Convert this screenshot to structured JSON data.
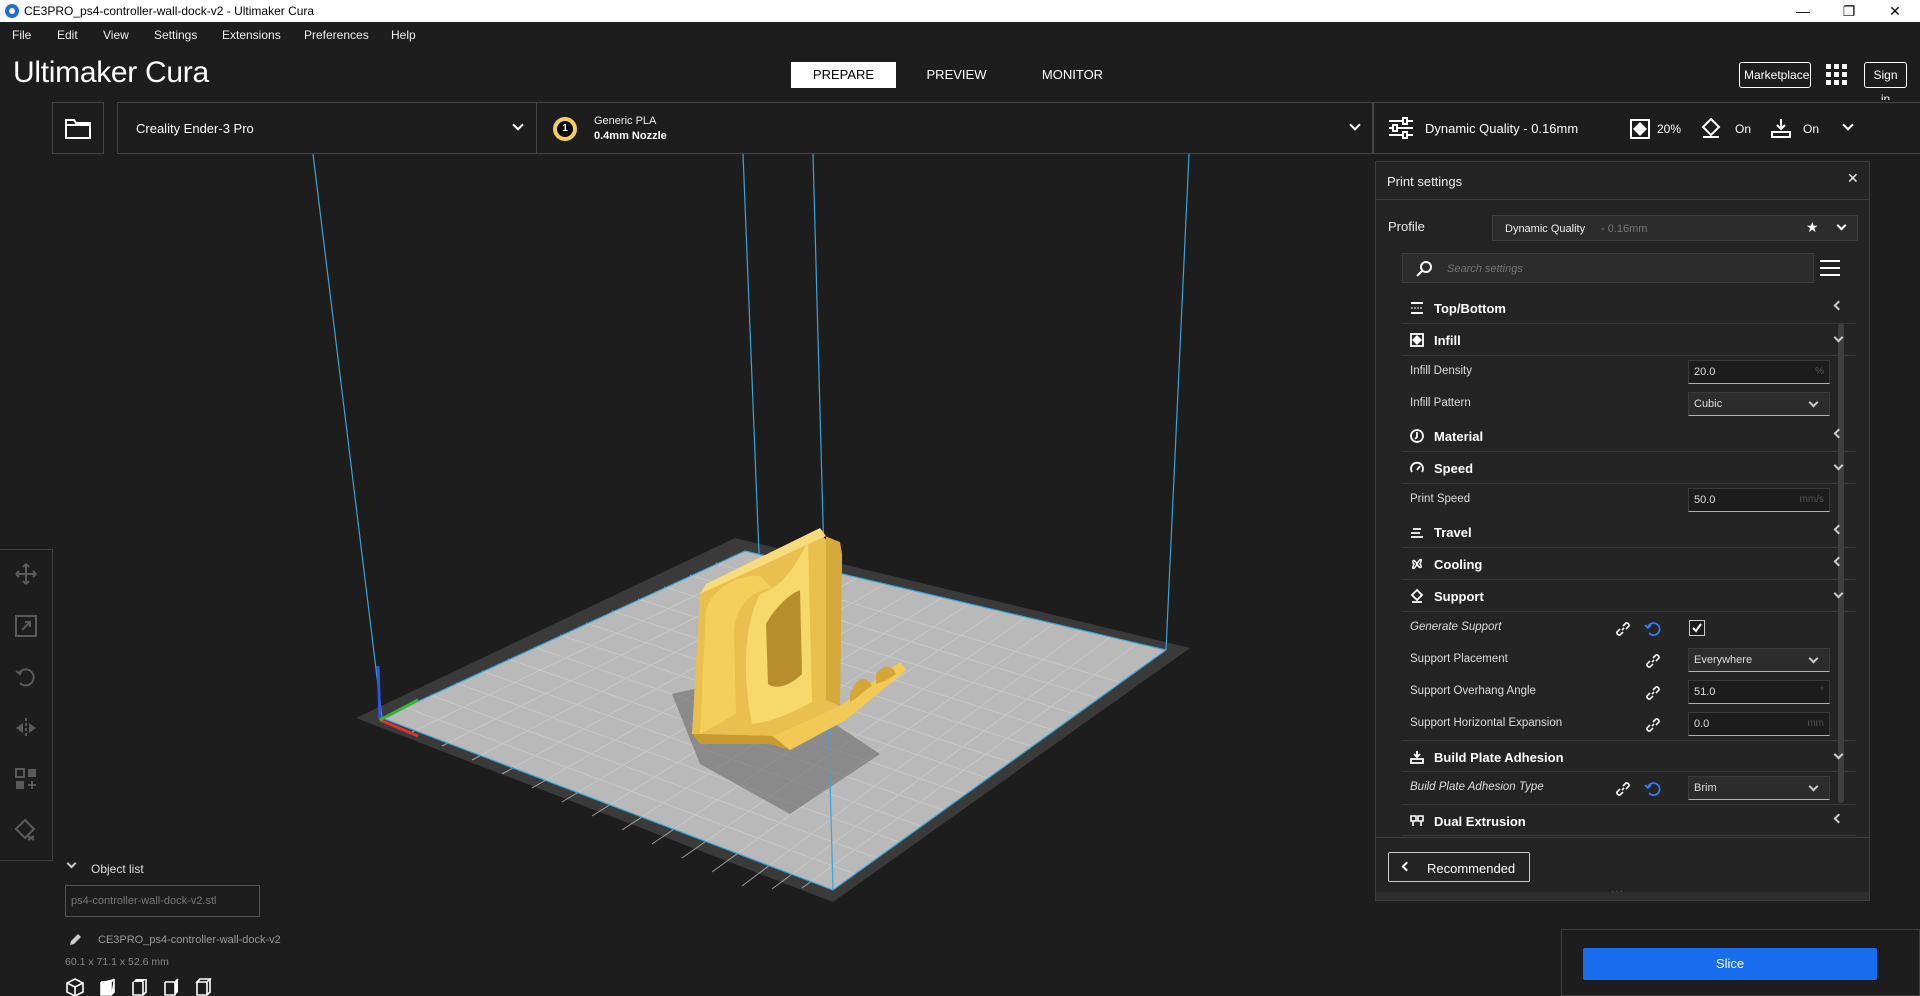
{
  "window": {
    "title": "CE3PRO_ps4-controller-wall-dock-v2 - Ultimaker Cura",
    "minimize": "—",
    "restore": "❐",
    "close": "✕"
  },
  "menu": [
    "File",
    "Edit",
    "View",
    "Settings",
    "Extensions",
    "Preferences",
    "Help"
  ],
  "header": {
    "logo_bold": "Ultimaker",
    "logo_light": " Cura",
    "stages": [
      "PREPARE",
      "PREVIEW",
      "MONITOR"
    ],
    "active_stage": "PREPARE",
    "marketplace": "Marketplace",
    "signin": "Sign in"
  },
  "toolbar": {
    "printer": "Creality Ender-3 Pro",
    "extruder_number": "1",
    "material": "Generic PLA",
    "nozzle": "0.4mm Nozzle",
    "profile": "Dynamic Quality - 0.16mm",
    "infill": "20%",
    "support": "On",
    "adhesion": "On"
  },
  "print_settings": {
    "title": "Print settings",
    "profile_label": "Profile",
    "profile_name": "Dynamic Quality",
    "profile_suffix": " - 0.16mm",
    "search_placeholder": "Search settings",
    "sections": {
      "top_bottom": "Top/Bottom",
      "infill": "Infill",
      "material": "Material",
      "speed": "Speed",
      "travel": "Travel",
      "cooling": "Cooling",
      "support": "Support",
      "build_plate": "Build Plate Adhesion",
      "dual": "Dual Extrusion"
    },
    "settings": {
      "infill_density": {
        "label": "Infill Density",
        "value": "20.0",
        "unit": "%"
      },
      "infill_pattern": {
        "label": "Infill Pattern",
        "value": "Cubic"
      },
      "print_speed": {
        "label": "Print Speed",
        "value": "50.0",
        "unit": "mm/s"
      },
      "generate_support": {
        "label": "Generate Support",
        "checked": true
      },
      "support_placement": {
        "label": "Support Placement",
        "value": "Everywhere"
      },
      "support_angle": {
        "label": "Support Overhang Angle",
        "value": "51.0",
        "unit": "°"
      },
      "support_expansion": {
        "label": "Support Horizontal Expansion",
        "value": "0.0",
        "unit": "mm"
      },
      "adhesion_type": {
        "label": "Build Plate Adhesion Type",
        "value": "Brim"
      }
    },
    "recommended": "Recommended"
  },
  "object_list": {
    "title": "Object list",
    "file": "ps4-controller-wall-dock-v2.stl",
    "job_name": "CE3PRO_ps4-controller-wall-dock-v2",
    "dimensions": "60.1 x 71.1 x 52.6 mm"
  },
  "slice": {
    "label": "Slice"
  },
  "colors": {
    "accent": "#196ef0",
    "model": "#f5cf5c",
    "background": "#1d1d1d",
    "build_volume": "#3aa3d8"
  }
}
